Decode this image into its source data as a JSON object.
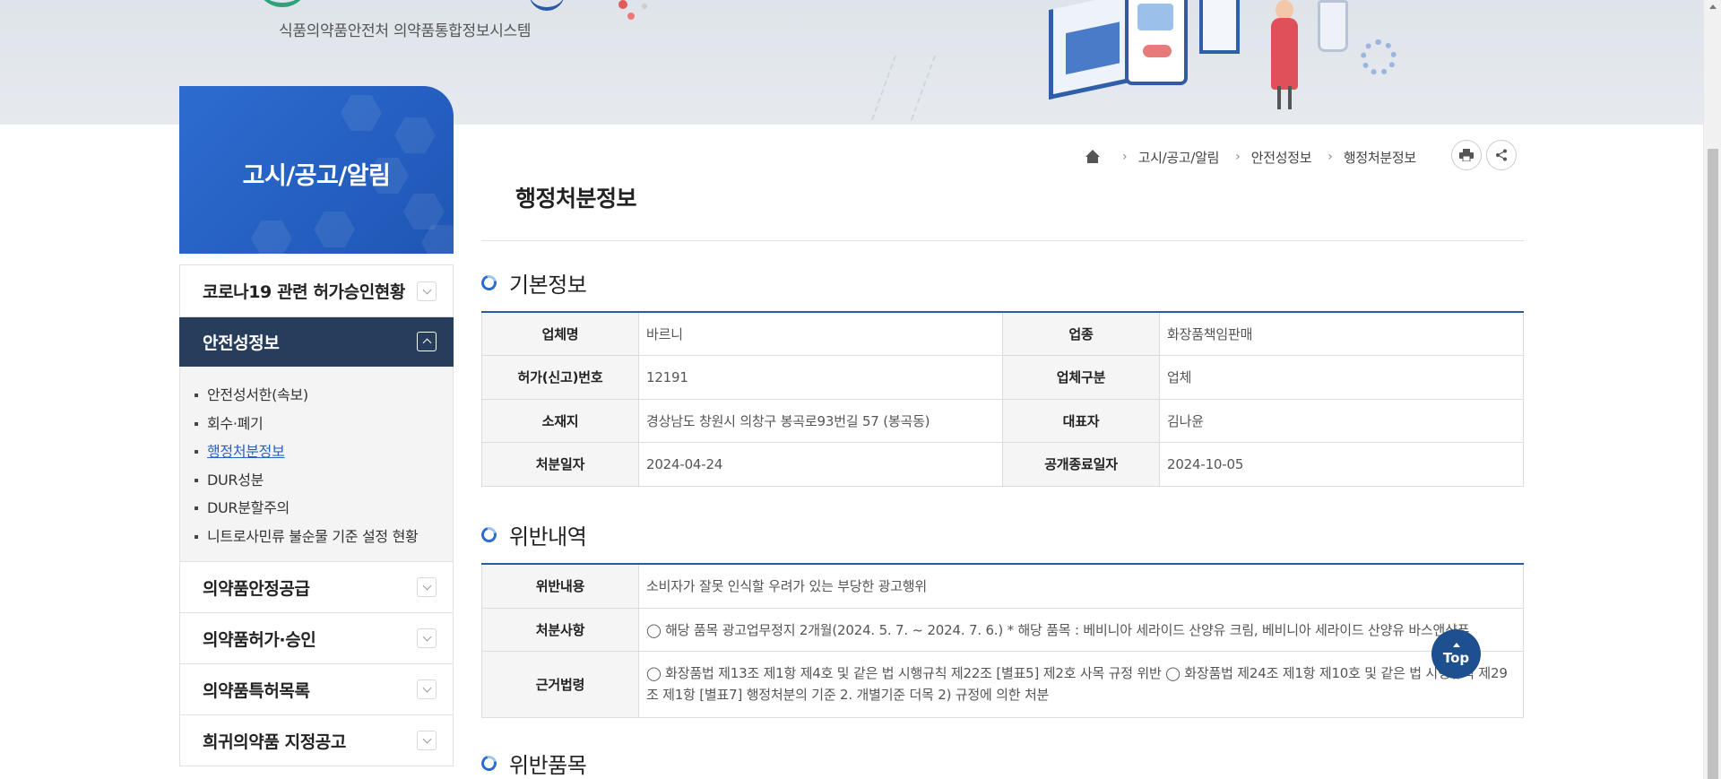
{
  "header": {
    "logo_subtitle": "식품의약품안전처 의약품통합정보시스템"
  },
  "sidebar": {
    "title": "고시/공고/알림",
    "items": [
      {
        "label": "코로나19 관련 허가승인현황"
      },
      {
        "label": "안전성정보"
      },
      {
        "label": "의약품안정공급"
      },
      {
        "label": "의약품허가·승인"
      },
      {
        "label": "의약품특허목록"
      },
      {
        "label": "희귀의약품 지정공고"
      }
    ],
    "subitems": [
      {
        "label": "안전성서한(속보)"
      },
      {
        "label": "회수·폐기"
      },
      {
        "label": "행정처분정보"
      },
      {
        "label": "DUR성분"
      },
      {
        "label": "DUR분할주의"
      },
      {
        "label": "니트로사민류 불순물 기준 설정 현황"
      }
    ]
  },
  "breadcrumb": {
    "items": [
      "고시/공고/알림",
      "안전성정보",
      "행정처분정보"
    ],
    "print_icon": "print-icon",
    "share_icon": "share-icon"
  },
  "page": {
    "title": "행정처분정보"
  },
  "basic_info": {
    "title": "기본정보",
    "rows": [
      {
        "h1": "업체명",
        "v1": "바르니",
        "h2": "업종",
        "v2": "화장품책임판매"
      },
      {
        "h1": "허가(신고)번호",
        "v1": "12191",
        "h2": "업체구분",
        "v2": "업체"
      },
      {
        "h1": "소재지",
        "v1": "경상남도 창원시 의창구 봉곡로93번길 57 (봉곡동)",
        "h2": "대표자",
        "v2": "김나윤"
      },
      {
        "h1": "처분일자",
        "v1": "2024-04-24",
        "h2": "공개종료일자",
        "v2": "2024-10-05"
      }
    ]
  },
  "violation": {
    "title": "위반내역",
    "rows": [
      {
        "h": "위반내용",
        "v": "소비자가 잘못 인식할 우려가 있는 부당한 광고행위"
      },
      {
        "h": "처분사항",
        "v": "◯ 해당 품목 광고업무정지 2개월(2024. 5. 7. ~ 2024. 7. 6.) * 해당 품목 : 베비니아 세라이드 산양유 크림, 베비니아 세라이드 산양유 바스앤샴푸"
      },
      {
        "h": "근거법령",
        "v": "◯ 화장품법 제13조 제1항 제4호 및 같은 법 시행규칙 제22조 [별표5] 제2호 사목 규정 위반 ◯ 화장품법 제24조 제1항 제10호 및 같은 법 시행규칙 제29조 제1항 [별표7] 행정처분의 기준 2. 개별기준 더목 2) 규정에 의한 처분"
      }
    ]
  },
  "items_section": {
    "title": "위반품목"
  },
  "top_button": {
    "label": "Top"
  }
}
